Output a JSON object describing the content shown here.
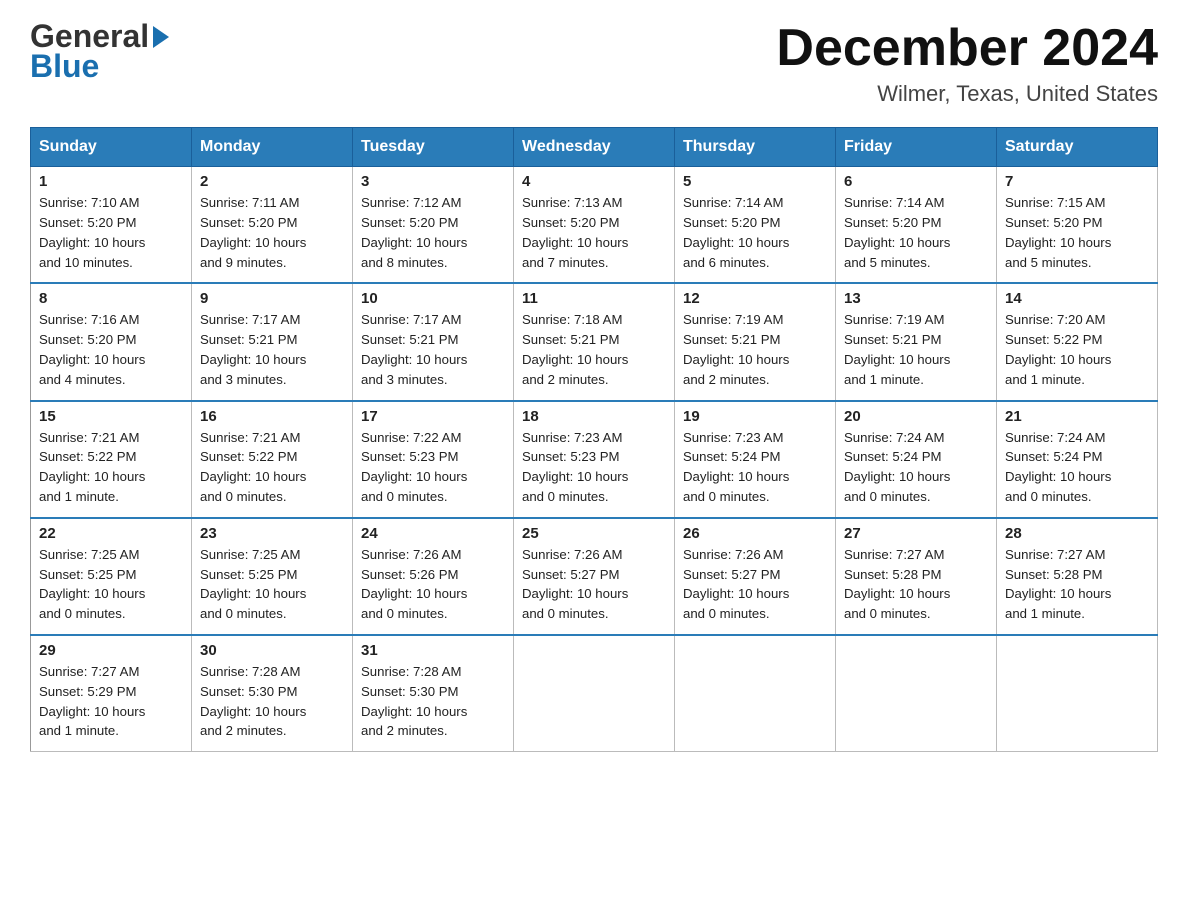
{
  "header": {
    "logo_general": "General",
    "logo_blue": "Blue",
    "month_title": "December 2024",
    "location": "Wilmer, Texas, United States"
  },
  "days_of_week": [
    "Sunday",
    "Monday",
    "Tuesday",
    "Wednesday",
    "Thursday",
    "Friday",
    "Saturday"
  ],
  "weeks": [
    [
      {
        "day": "1",
        "sunrise": "7:10 AM",
        "sunset": "5:20 PM",
        "daylight": "10 hours and 10 minutes."
      },
      {
        "day": "2",
        "sunrise": "7:11 AM",
        "sunset": "5:20 PM",
        "daylight": "10 hours and 9 minutes."
      },
      {
        "day": "3",
        "sunrise": "7:12 AM",
        "sunset": "5:20 PM",
        "daylight": "10 hours and 8 minutes."
      },
      {
        "day": "4",
        "sunrise": "7:13 AM",
        "sunset": "5:20 PM",
        "daylight": "10 hours and 7 minutes."
      },
      {
        "day": "5",
        "sunrise": "7:14 AM",
        "sunset": "5:20 PM",
        "daylight": "10 hours and 6 minutes."
      },
      {
        "day": "6",
        "sunrise": "7:14 AM",
        "sunset": "5:20 PM",
        "daylight": "10 hours and 5 minutes."
      },
      {
        "day": "7",
        "sunrise": "7:15 AM",
        "sunset": "5:20 PM",
        "daylight": "10 hours and 5 minutes."
      }
    ],
    [
      {
        "day": "8",
        "sunrise": "7:16 AM",
        "sunset": "5:20 PM",
        "daylight": "10 hours and 4 minutes."
      },
      {
        "day": "9",
        "sunrise": "7:17 AM",
        "sunset": "5:21 PM",
        "daylight": "10 hours and 3 minutes."
      },
      {
        "day": "10",
        "sunrise": "7:17 AM",
        "sunset": "5:21 PM",
        "daylight": "10 hours and 3 minutes."
      },
      {
        "day": "11",
        "sunrise": "7:18 AM",
        "sunset": "5:21 PM",
        "daylight": "10 hours and 2 minutes."
      },
      {
        "day": "12",
        "sunrise": "7:19 AM",
        "sunset": "5:21 PM",
        "daylight": "10 hours and 2 minutes."
      },
      {
        "day": "13",
        "sunrise": "7:19 AM",
        "sunset": "5:21 PM",
        "daylight": "10 hours and 1 minute."
      },
      {
        "day": "14",
        "sunrise": "7:20 AM",
        "sunset": "5:22 PM",
        "daylight": "10 hours and 1 minute."
      }
    ],
    [
      {
        "day": "15",
        "sunrise": "7:21 AM",
        "sunset": "5:22 PM",
        "daylight": "10 hours and 1 minute."
      },
      {
        "day": "16",
        "sunrise": "7:21 AM",
        "sunset": "5:22 PM",
        "daylight": "10 hours and 0 minutes."
      },
      {
        "day": "17",
        "sunrise": "7:22 AM",
        "sunset": "5:23 PM",
        "daylight": "10 hours and 0 minutes."
      },
      {
        "day": "18",
        "sunrise": "7:23 AM",
        "sunset": "5:23 PM",
        "daylight": "10 hours and 0 minutes."
      },
      {
        "day": "19",
        "sunrise": "7:23 AM",
        "sunset": "5:24 PM",
        "daylight": "10 hours and 0 minutes."
      },
      {
        "day": "20",
        "sunrise": "7:24 AM",
        "sunset": "5:24 PM",
        "daylight": "10 hours and 0 minutes."
      },
      {
        "day": "21",
        "sunrise": "7:24 AM",
        "sunset": "5:24 PM",
        "daylight": "10 hours and 0 minutes."
      }
    ],
    [
      {
        "day": "22",
        "sunrise": "7:25 AM",
        "sunset": "5:25 PM",
        "daylight": "10 hours and 0 minutes."
      },
      {
        "day": "23",
        "sunrise": "7:25 AM",
        "sunset": "5:25 PM",
        "daylight": "10 hours and 0 minutes."
      },
      {
        "day": "24",
        "sunrise": "7:26 AM",
        "sunset": "5:26 PM",
        "daylight": "10 hours and 0 minutes."
      },
      {
        "day": "25",
        "sunrise": "7:26 AM",
        "sunset": "5:27 PM",
        "daylight": "10 hours and 0 minutes."
      },
      {
        "day": "26",
        "sunrise": "7:26 AM",
        "sunset": "5:27 PM",
        "daylight": "10 hours and 0 minutes."
      },
      {
        "day": "27",
        "sunrise": "7:27 AM",
        "sunset": "5:28 PM",
        "daylight": "10 hours and 0 minutes."
      },
      {
        "day": "28",
        "sunrise": "7:27 AM",
        "sunset": "5:28 PM",
        "daylight": "10 hours and 1 minute."
      }
    ],
    [
      {
        "day": "29",
        "sunrise": "7:27 AM",
        "sunset": "5:29 PM",
        "daylight": "10 hours and 1 minute."
      },
      {
        "day": "30",
        "sunrise": "7:28 AM",
        "sunset": "5:30 PM",
        "daylight": "10 hours and 2 minutes."
      },
      {
        "day": "31",
        "sunrise": "7:28 AM",
        "sunset": "5:30 PM",
        "daylight": "10 hours and 2 minutes."
      },
      null,
      null,
      null,
      null
    ]
  ],
  "labels": {
    "sunrise": "Sunrise:",
    "sunset": "Sunset:",
    "daylight": "Daylight:"
  }
}
